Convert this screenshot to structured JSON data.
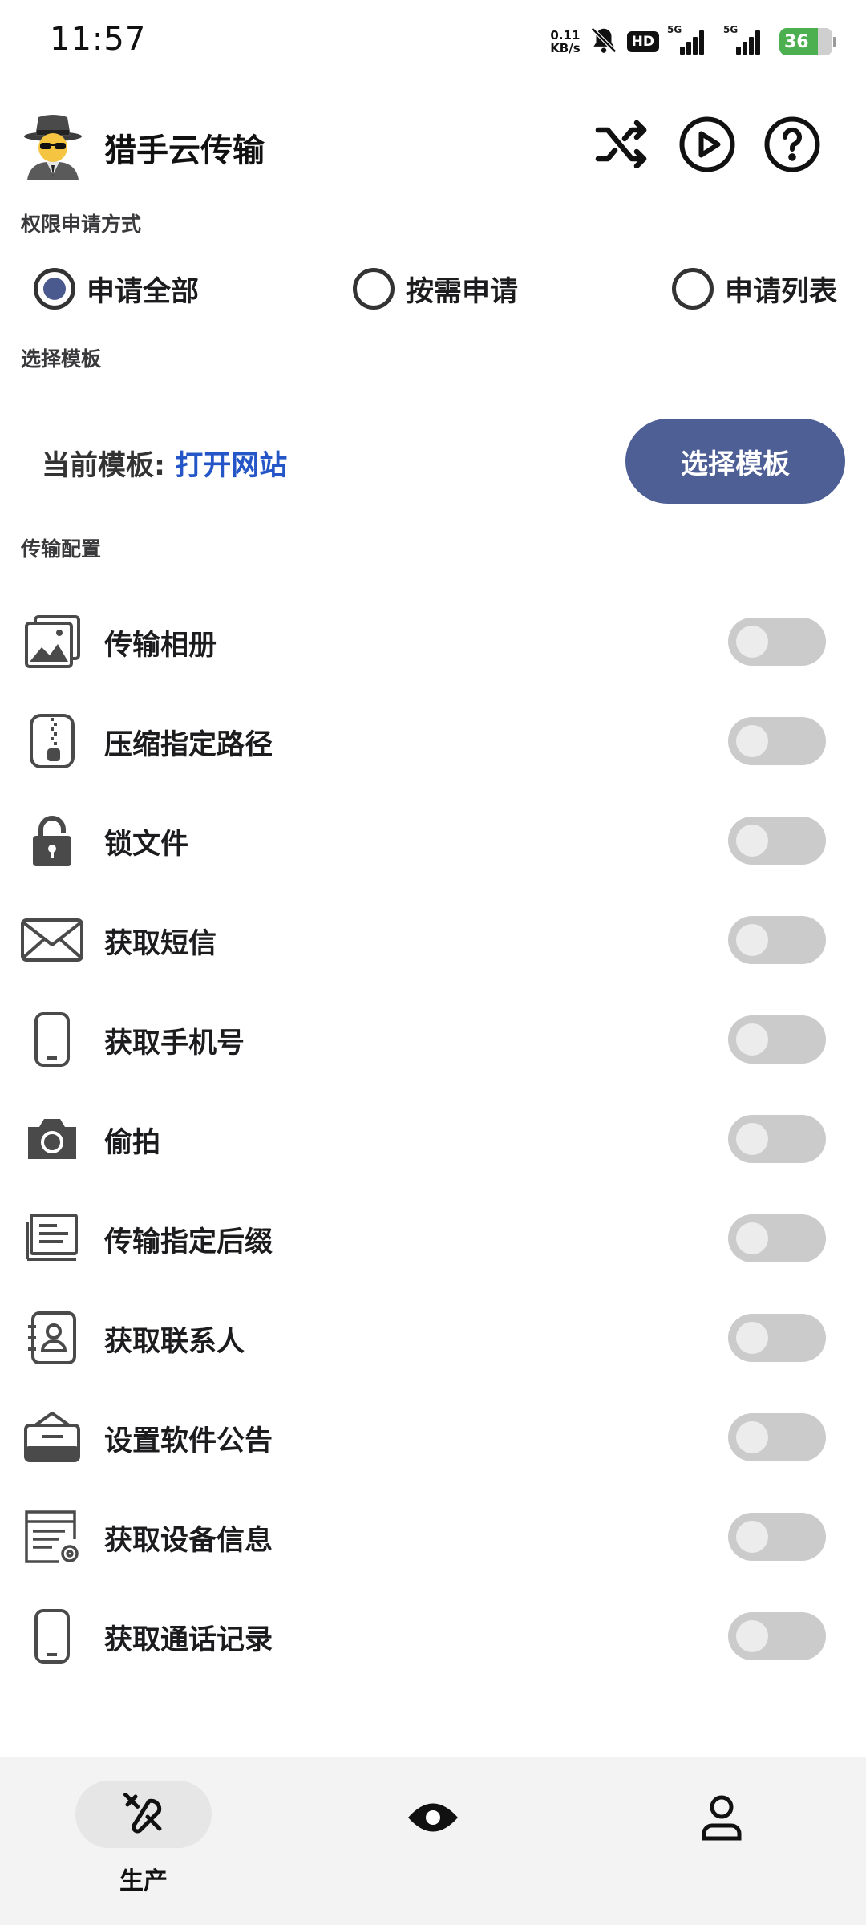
{
  "status_bar": {
    "time": "11:57",
    "net_speed_value": "0.11",
    "net_speed_unit": "KB/s",
    "hd": "HD",
    "signal1_label": "5G",
    "signal2_label": "5G",
    "battery": "36",
    "battery_color": "#4caf50"
  },
  "header": {
    "title": "猎手云传输",
    "icons": [
      "shuffle-icon",
      "play-circle-icon",
      "help-circle-icon"
    ]
  },
  "permission": {
    "section_label": "权限申请方式",
    "options": [
      {
        "label": "申请全部",
        "selected": true
      },
      {
        "label": "按需申请",
        "selected": false
      },
      {
        "label": "申请列表",
        "selected": false
      }
    ]
  },
  "template": {
    "section_label": "选择模板",
    "current_prefix": "当前模板: ",
    "current_value": "打开网站",
    "button_label": "选择模板",
    "accent": "#4e5f96",
    "link_color": "#2456c8"
  },
  "config": {
    "section_label": "传输配置",
    "items": [
      {
        "label": "传输相册",
        "icon": "gallery-icon",
        "enabled": false
      },
      {
        "label": "压缩指定路径",
        "icon": "zip-file-icon",
        "enabled": false
      },
      {
        "label": "锁文件",
        "icon": "lock-icon",
        "enabled": false
      },
      {
        "label": "获取短信",
        "icon": "envelope-icon",
        "enabled": false
      },
      {
        "label": "获取手机号",
        "icon": "phone-icon",
        "enabled": false
      },
      {
        "label": "偷拍",
        "icon": "camera-icon",
        "enabled": false
      },
      {
        "label": "传输指定后缀",
        "icon": "document-icon",
        "enabled": false
      },
      {
        "label": "获取联系人",
        "icon": "contact-book-icon",
        "enabled": false
      },
      {
        "label": "设置软件公告",
        "icon": "announcement-icon",
        "enabled": false
      },
      {
        "label": "获取设备信息",
        "icon": "device-info-icon",
        "enabled": false
      },
      {
        "label": "获取通话记录",
        "icon": "phone-icon",
        "enabled": false
      }
    ]
  },
  "bottom_nav": {
    "items": [
      {
        "label": "生产",
        "icon": "tools-icon",
        "active": true
      },
      {
        "label": "",
        "icon": "eye-icon",
        "active": false
      },
      {
        "label": "",
        "icon": "user-icon",
        "active": false
      }
    ]
  }
}
